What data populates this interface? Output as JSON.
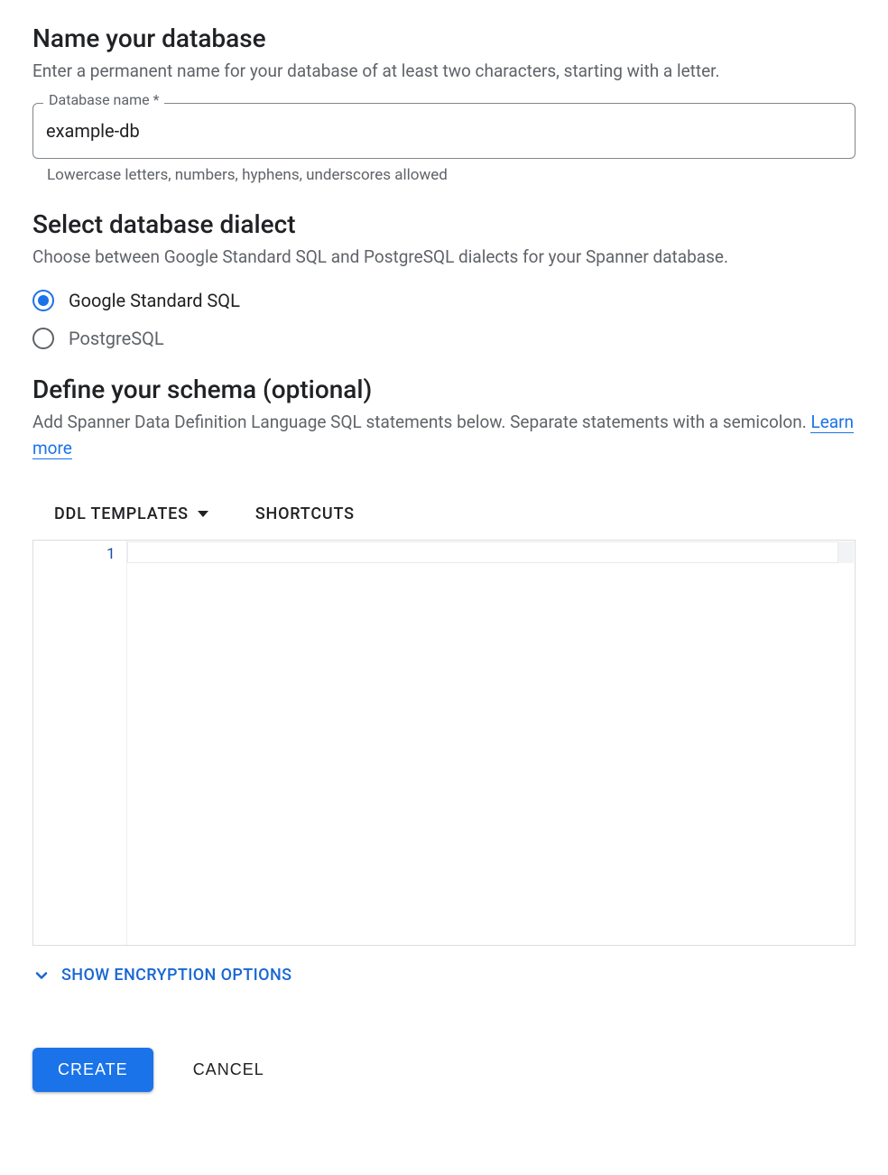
{
  "name_section": {
    "title": "Name your database",
    "desc": "Enter a permanent name for your database of at least two characters, starting with a letter.",
    "field_label": "Database name *",
    "field_value": "example-db",
    "helper": "Lowercase letters, numbers, hyphens, underscores allowed"
  },
  "dialect_section": {
    "title": "Select database dialect",
    "desc": "Choose between Google Standard SQL and PostgreSQL dialects for your Spanner database.",
    "options": [
      {
        "label": "Google Standard SQL",
        "selected": true
      },
      {
        "label": "PostgreSQL",
        "selected": false
      }
    ]
  },
  "schema_section": {
    "title": "Define your schema (optional)",
    "desc_prefix": "Add Spanner Data Definition Language SQL statements below. Separate statements with a semicolon. ",
    "learn_more": "Learn more",
    "toolbar": {
      "ddl_templates": "DDL TEMPLATES",
      "shortcuts": "SHORTCUTS"
    },
    "editor": {
      "line_number": "1"
    }
  },
  "encryption": {
    "label": "SHOW ENCRYPTION OPTIONS"
  },
  "actions": {
    "create": "CREATE",
    "cancel": "CANCEL"
  }
}
